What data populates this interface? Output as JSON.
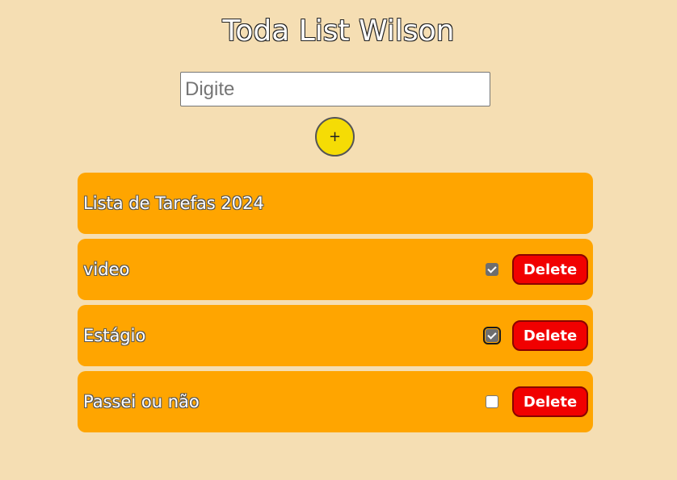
{
  "app": {
    "title": "Toda List Wilson"
  },
  "form": {
    "input_placeholder": "Digite",
    "input_value": "",
    "add_button_label": "+"
  },
  "list": {
    "header": "Lista de Tarefas 2024",
    "tasks": [
      {
        "text": "video",
        "checked": true,
        "delete_label": "Delete"
      },
      {
        "text": "Estágio",
        "checked": true,
        "delete_label": "Delete"
      },
      {
        "text": "Passei ou não",
        "checked": false,
        "delete_label": "Delete"
      }
    ]
  },
  "colors": {
    "background": "#f5deb3",
    "row": "#ffa500",
    "add_button": "#f5dc05",
    "delete_button": "#f10000"
  }
}
